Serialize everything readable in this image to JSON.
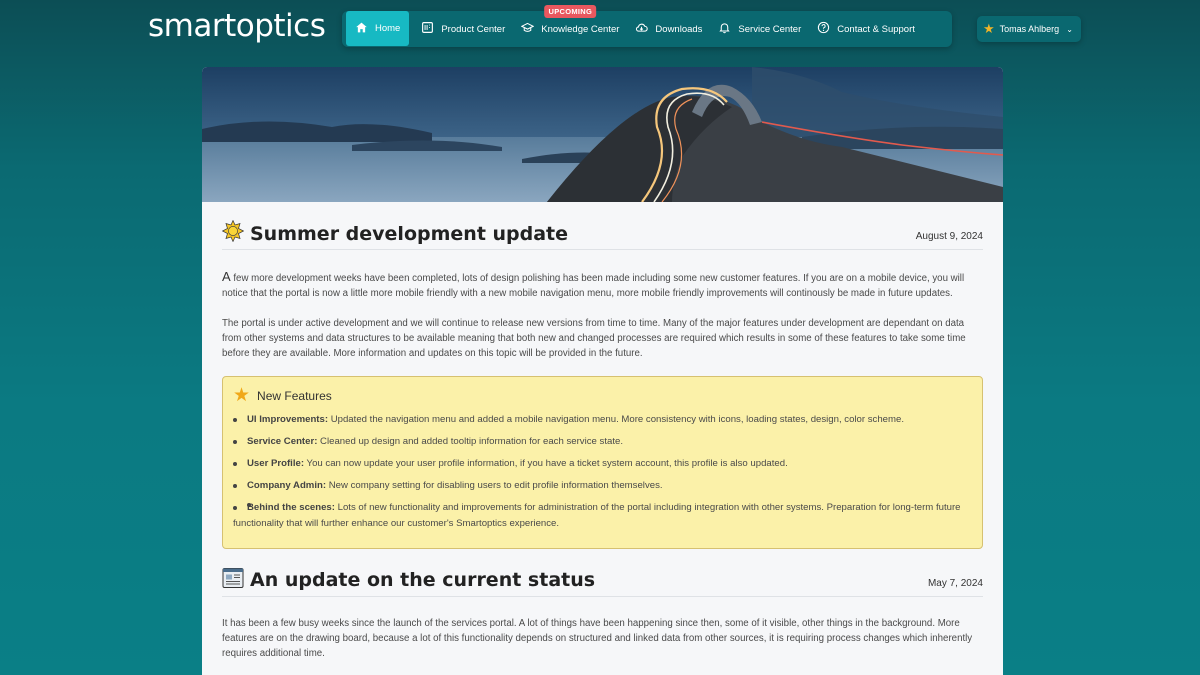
{
  "header": {
    "logo": "smartoptics",
    "nav": [
      {
        "label": "Home",
        "icon": "home-icon",
        "active": true
      },
      {
        "label": "Product Center",
        "icon": "product-icon"
      },
      {
        "label": "Knowledge Center",
        "icon": "graduation-cap-icon",
        "badge": "UPCOMING"
      },
      {
        "label": "Downloads",
        "icon": "cloud-download-icon"
      },
      {
        "label": "Service Center",
        "icon": "bell-icon"
      },
      {
        "label": "Contact & Support",
        "icon": "question-circle-icon"
      }
    ],
    "user": {
      "name": "Tomas Ahlberg",
      "icon": "star-icon"
    }
  },
  "posts": [
    {
      "icon": "sun-icon",
      "title": "Summer development update",
      "date": "August 9, 2024",
      "p1_first": "A",
      "p1_rest": " few more development weeks have been completed, lots of design polishing has been made including some new customer features. If you are on a mobile device, you will notice that the portal is now a little more mobile friendly with a new mobile navigation menu, more mobile friendly improvements will continously be made in future updates.",
      "p2": "The portal is under active development and we will continue to release new versions from time to time. Many of the major features under development are dependant on data from other systems and data structures to be available meaning that both new and changed processes are required which results in some of these features to take some time before they are available. More information and updates on this topic will be provided in the future.",
      "features": {
        "title": "New Features",
        "icon": "star-icon",
        "items": [
          {
            "label": "UI Improvements:",
            "text": " Updated the navigation menu and added a mobile navigation menu. More consistency with icons, loading states, design, color scheme."
          },
          {
            "label": "Service Center:",
            "text": " Cleaned up design and added tooltip information for each service state."
          },
          {
            "label": "User Profile:",
            "text": " You can now update your user profile information, if you have a ticket system account, this profile is also updated."
          },
          {
            "label": "Company Admin:",
            "text": " New company setting for disabling users to edit profile information themselves."
          },
          {
            "label": "Behind the scenes:",
            "text": " Lots of new functionality and improvements for administration of the portal including integration with other systems. Preparation for long-term future functionality that will further enhance our customer's Smartoptics experience."
          }
        ]
      }
    },
    {
      "icon": "newspaper-icon",
      "title": "An update on the current status",
      "date": "May 7, 2024",
      "p1": "It has been a few busy weeks since the launch of the services portal. A lot of things have been happening since then, some of it visible, other things in the background. More features are on the drawing board, because a lot of this functionality depends on structured and linked data from other sources, it is requiring process changes which inherently requires additional time."
    }
  ],
  "colors": {
    "background": "#0b6a72",
    "nav_active": "#17b9c3",
    "badge": "#e9585f",
    "features_bg": "#fbf1a9"
  }
}
